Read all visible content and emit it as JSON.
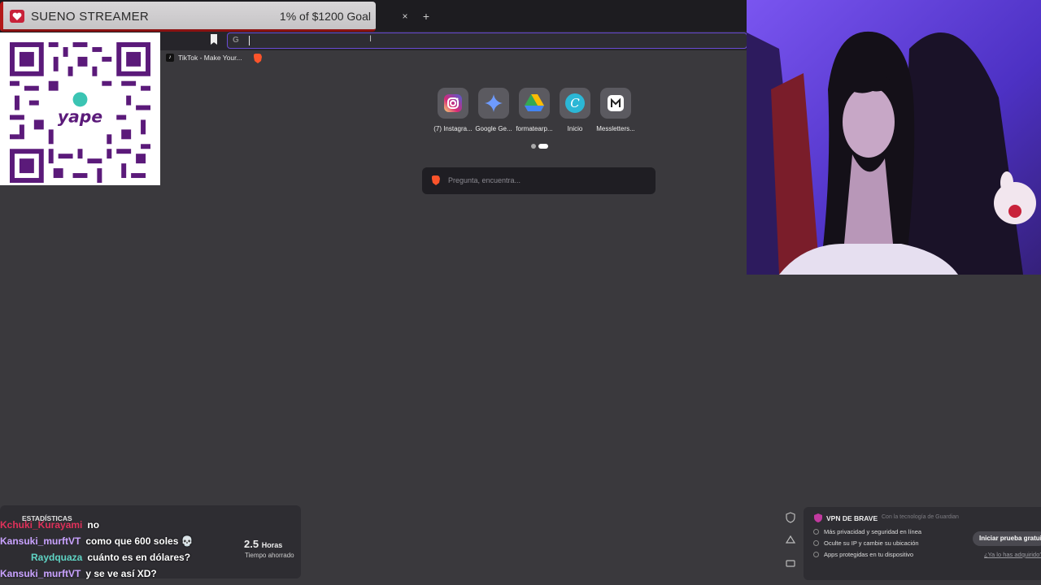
{
  "goal": {
    "title": "SUENO STREAMER",
    "amount": "1% of $1200 Goal"
  },
  "browser": {
    "tab_close": "×",
    "tab_new": "+",
    "url_g": "G",
    "bookmarks": [
      {
        "label": "TikTok - Make Your..."
      }
    ]
  },
  "shortcuts": [
    {
      "label": "(7) Instagra...",
      "icon": "instagram-icon"
    },
    {
      "label": "Google Ge...",
      "icon": "gemini-icon"
    },
    {
      "label": "formatearp...",
      "icon": "google-drive-icon"
    },
    {
      "label": "Inicio",
      "icon": "canva-icon"
    },
    {
      "label": "Messletters...",
      "icon": "messletters-icon"
    }
  ],
  "search": {
    "placeholder": "Pregunta, encuentra..."
  },
  "stats": {
    "title": "ESTADÍSTICAS",
    "hours_value": "2.5",
    "hours_unit": "Horas",
    "hours_label": "Tiempo ahorrado"
  },
  "chat": [
    {
      "user": "Kchuki_Kurayami",
      "message": "no",
      "color": "#e0315a"
    },
    {
      "user": "Kansuki_murftVT",
      "message": "como que 600 soles 💀",
      "color": "#c9a2ff"
    },
    {
      "user": "Raydquaza",
      "message": "cuánto es en dólares?",
      "color": "#5fd4c4"
    },
    {
      "user": "Kansuki_murftVT",
      "message": "y se ve así XD?",
      "color": "#c9a2ff"
    }
  ],
  "vpn": {
    "title": "VPN DE BRAVE",
    "powered": "Con la tecnología de Guardian",
    "features": [
      "Más privacidad y seguridad en línea",
      "Oculte su IP y cambie su ubicación",
      "Apps protegidas en tu dispositivo"
    ],
    "button": "Iniciar prueba gratuita",
    "link": "¿Ya lo has adquirido?"
  },
  "colors": {
    "accent": "#6a4bd6",
    "brave": "#fb542b",
    "background": "#3a393d"
  }
}
